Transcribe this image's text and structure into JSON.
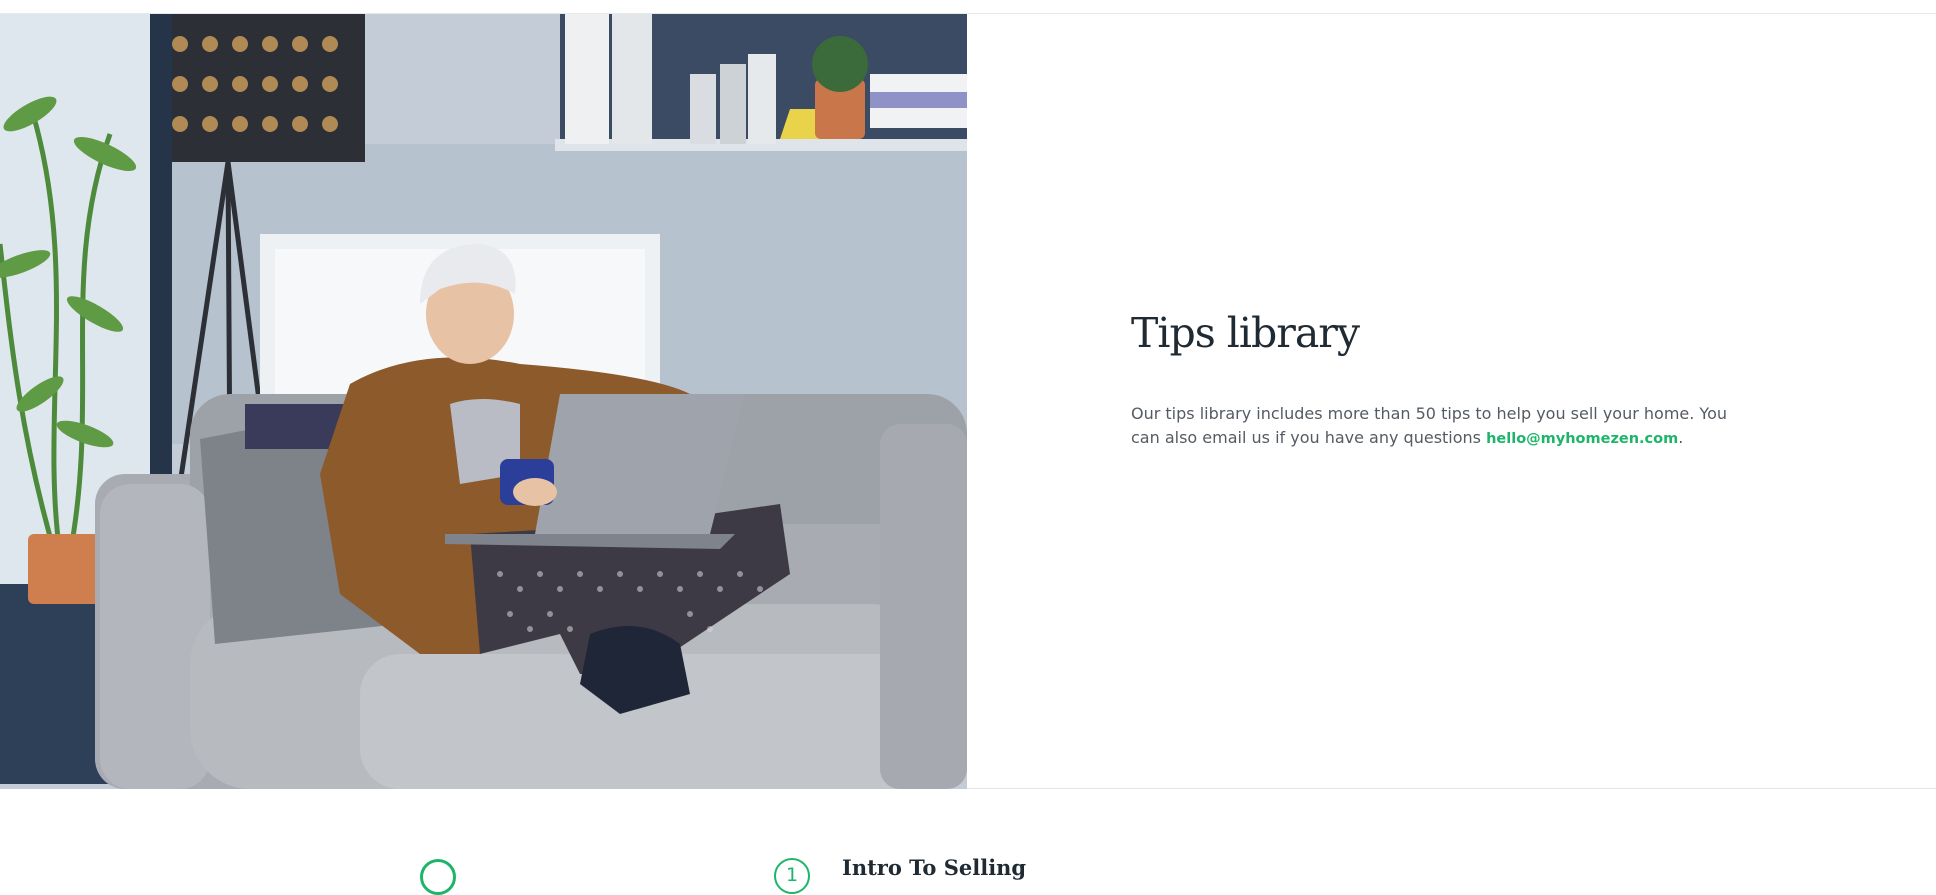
{
  "hero": {
    "photo_alt": "Woman on a sofa with a laptop and a mug",
    "title": "Tips library",
    "description": "Our tips library includes more than 50 tips to help you sell your home. You can also email us if you have any questions ",
    "email": "hello@myhomezen.com",
    "description_end": "."
  },
  "steps": {
    "items": [
      {
        "number": "",
        "title": ""
      },
      {
        "number": "1",
        "title": "Intro To Selling"
      }
    ]
  },
  "colors": {
    "accent": "#1cb56a",
    "heading": "#1f2a33",
    "body_text": "#545b62"
  }
}
